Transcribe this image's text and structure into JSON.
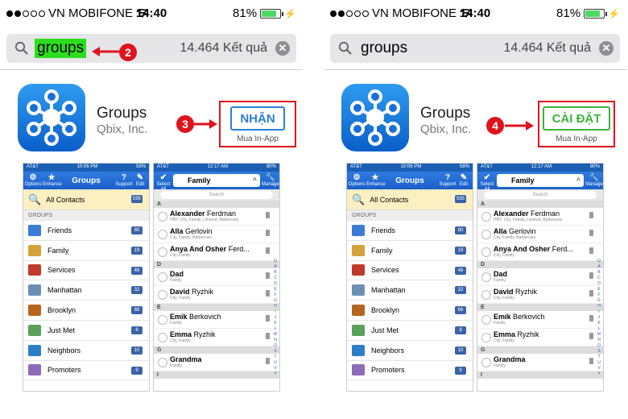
{
  "panels": [
    {
      "status": {
        "carrier": "VN MOBIFONE",
        "time": "14:40",
        "battery": "81%"
      },
      "search": {
        "query": "groups",
        "results": "14.464 Kết quả"
      },
      "app": {
        "name": "Groups",
        "developer": "Qbix, Inc.",
        "button": "NHẬN",
        "in_app": "Mua In-App"
      },
      "steps": [
        "2",
        "3"
      ]
    },
    {
      "status": {
        "carrier": "VN MOBIFONE",
        "time": "14:40",
        "battery": "81%"
      },
      "search": {
        "query": "groups",
        "results": "14.464 Kết quả"
      },
      "app": {
        "name": "Groups",
        "developer": "Qbix, Inc.",
        "button": "CÀI ĐẶT",
        "in_app": "Mua In-App"
      },
      "steps": [
        "4"
      ]
    }
  ],
  "shot_groups": {
    "carrier": "AT&T",
    "time": "10:06 PM",
    "batt": "58%",
    "title": "Groups",
    "btn_left": "Options",
    "btn_left2": "Enhance",
    "btn_right": "Support",
    "btn_right2": "Edit",
    "all": "All Contacts",
    "all_count": "595",
    "groups_label": "GROUPS",
    "items": [
      {
        "name": "Friends",
        "count": "80"
      },
      {
        "name": "Family",
        "count": "19"
      },
      {
        "name": "Services",
        "count": "48"
      },
      {
        "name": "Manhattan",
        "count": "32"
      },
      {
        "name": "Brooklyn",
        "count": "66"
      },
      {
        "name": "Just Met",
        "count": "8"
      },
      {
        "name": "Neighbors",
        "count": "10"
      },
      {
        "name": "Promoters",
        "count": "9"
      }
    ]
  },
  "shot_contacts": {
    "carrier": "AT&T",
    "time": "12:17 AM",
    "batt": "80%",
    "title": "Family",
    "btn_left": "Select All",
    "btn_right": "Manage",
    "search": "Search",
    "rows": [
      {
        "sec": "A"
      },
      {
        "first": "Alexander",
        "last": "Ferdman",
        "sub": "HNY, City, Family, Limmud, Barbecues"
      },
      {
        "first": "Alla",
        "last": "Gerlovin",
        "sub": "City, Family, Barbecues"
      },
      {
        "first": "Anya And Osher",
        "last": "Ferd...",
        "sub": "City, Family"
      },
      {
        "sec": "D"
      },
      {
        "first": "Dad",
        "last": "",
        "sub": "Family"
      },
      {
        "first": "David",
        "last": "Ryzhik",
        "sub": "City, Family"
      },
      {
        "sec": "E"
      },
      {
        "first": "Emik",
        "last": "Berkovich",
        "sub": "Family"
      },
      {
        "first": "Emma",
        "last": "Ryzhik",
        "sub": "City, Family"
      },
      {
        "sec": "G"
      },
      {
        "first": "Grandma",
        "last": "",
        "sub": "Family"
      },
      {
        "sec": "I"
      }
    ],
    "index": "Q A B C D E F G H I J K L M N O S T U V Y"
  },
  "colors": {
    "annotation": "#e0131c",
    "highlight": "#2dde1f",
    "get_blue": "#2a7fd8",
    "install_green": "#3cb43c"
  },
  "icons": [
    "search-icon",
    "wifi-icon",
    "battery-icon",
    "clear-icon",
    "groups-app-icon",
    "arrow-icon"
  ]
}
